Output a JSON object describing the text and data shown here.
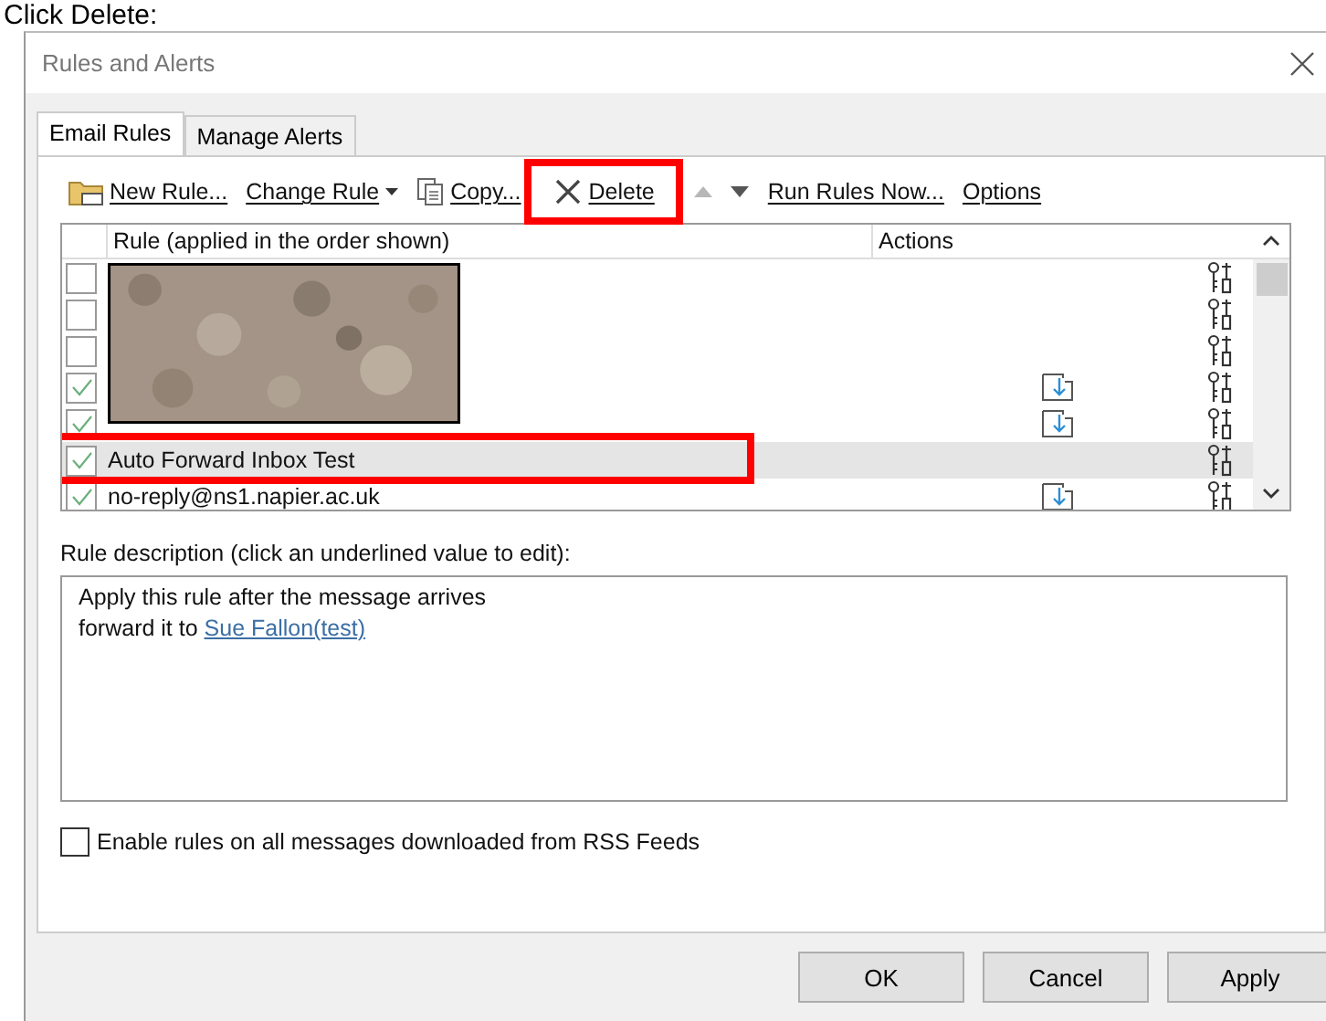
{
  "heading": "Click Delete:",
  "window": {
    "title": "Rules and Alerts"
  },
  "tabs": [
    {
      "label": "Email Rules",
      "selected": true
    },
    {
      "label": "Manage Alerts",
      "selected": false
    }
  ],
  "toolbar": [
    {
      "kind": "new",
      "label": "New Rule...",
      "disabled": false
    },
    {
      "kind": "change",
      "label": "Change Rule",
      "disabled": false
    },
    {
      "kind": "copy",
      "label": "Copy...",
      "disabled": false
    },
    {
      "kind": "delete",
      "label": "Delete",
      "disabled": false,
      "highlighted": true
    },
    {
      "kind": "up",
      "disabled": true
    },
    {
      "kind": "down",
      "disabled": false
    },
    {
      "kind": "run",
      "label": "Run Rules Now...",
      "disabled": false
    },
    {
      "kind": "options",
      "label": "Options",
      "disabled": false
    }
  ],
  "table": {
    "columns": [
      "Rule (applied in the order shown)",
      "Actions"
    ],
    "rows": [
      {
        "checked": false,
        "forward": false,
        "selected": false
      },
      {
        "checked": false,
        "forward": false,
        "selected": false
      },
      {
        "checked": false,
        "forward": false,
        "selected": false
      },
      {
        "checked": true,
        "forward": true,
        "selected": false
      },
      {
        "checked": true,
        "forward": true,
        "selected": false
      },
      {
        "checked": true,
        "name": "Auto Forward Inbox Test",
        "forward": false,
        "selected": true,
        "highlighted": true
      },
      {
        "checked": true,
        "name": "no-reply@ns1.napier.ac.uk",
        "forward": true,
        "selected": false
      }
    ],
    "blurred": {
      "kind": "picture"
    }
  },
  "description": {
    "label": "Rule description (click an underlined value to edit):",
    "lines": [
      {
        "text": "Apply this rule after the message arrives"
      },
      {
        "text": "forward it to ",
        "link": "Sue Fallon(test)"
      }
    ]
  },
  "rss_option": {
    "label": "Enable rules on all messages downloaded from RSS Feeds",
    "checked": false
  },
  "buttons": [
    "OK",
    "Cancel",
    "Apply"
  ]
}
